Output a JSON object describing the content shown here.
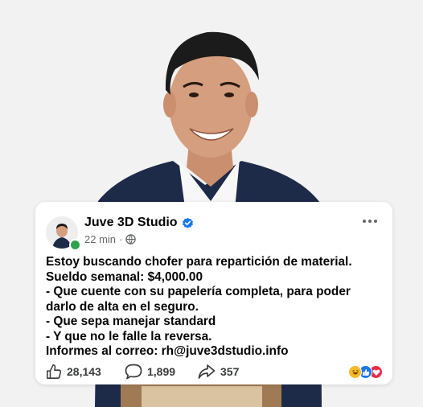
{
  "post": {
    "author": "Juve 3D Studio",
    "time": "22 min",
    "separator": "·",
    "body_lines": [
      "Estoy buscando chofer para repartición de material.",
      "Sueldo semanal: $4,000.00",
      "- Que cuente con su papelería completa, para poder",
      "darlo de alta en el seguro.",
      "- Que sepa manejar standard",
      "- Y que no le falle la reversa.",
      "Informes al correo: rh@juve3dstudio.info"
    ],
    "likes": "28,143",
    "comments": "1,899",
    "shares": "357"
  },
  "icons": {
    "verified": "verified-badge-icon",
    "audience": "globe-icon",
    "more": "more-options-icon",
    "like": "thumbs-up-icon",
    "comment": "comment-bubble-icon",
    "share": "share-arrow-icon",
    "reactions": [
      "haha-reaction-icon",
      "like-reaction-icon",
      "love-reaction-icon"
    ]
  },
  "colors": {
    "verified": "#1877f2",
    "online": "#31a24c",
    "like_reaction": "#1877f2",
    "love_reaction": "#f0284a",
    "haha_reaction": "#f7b928"
  }
}
